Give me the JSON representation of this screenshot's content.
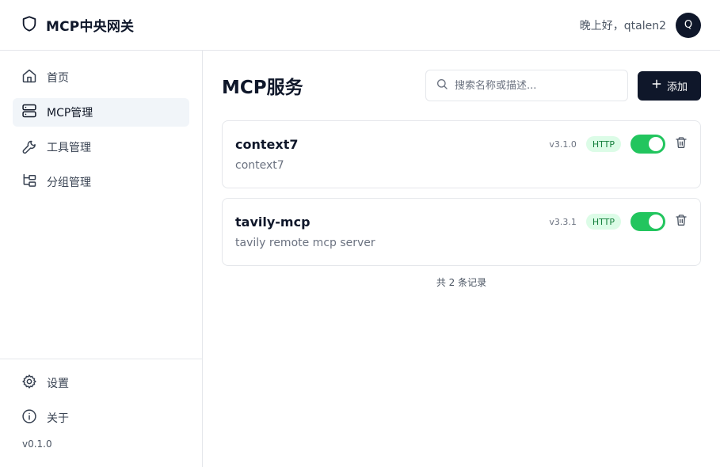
{
  "header": {
    "title": "MCP中央网关",
    "greeting": "晚上好，qtalen2",
    "avatar_initial": "Q"
  },
  "sidebar": {
    "items": [
      {
        "label": "首页",
        "icon": "home-icon",
        "active": false
      },
      {
        "label": "MCP管理",
        "icon": "server-icon",
        "active": true
      },
      {
        "label": "工具管理",
        "icon": "wrench-icon",
        "active": false
      },
      {
        "label": "分组管理",
        "icon": "folder-tree-icon",
        "active": false
      }
    ],
    "bottom_items": [
      {
        "label": "设置",
        "icon": "gear-icon"
      },
      {
        "label": "关于",
        "icon": "info-icon"
      }
    ],
    "version": "v0.1.0"
  },
  "main": {
    "title": "MCP服务",
    "search_placeholder": "搜索名称或描述...",
    "add_label": "添加",
    "services": [
      {
        "name": "context7",
        "version": "v3.1.0",
        "protocol": "HTTP",
        "enabled": true,
        "description": "context7"
      },
      {
        "name": "tavily-mcp",
        "version": "v3.3.1",
        "protocol": "HTTP",
        "enabled": true,
        "description": "tavily remote mcp server"
      }
    ],
    "total_text": "共 2 条记录"
  },
  "colors": {
    "primary": "#0f172a",
    "toggle_on": "#22c55e",
    "badge_bg": "#dcfce7",
    "badge_text": "#15803d",
    "active_nav_bg": "#f1f5f9",
    "border": "#e5e7eb"
  }
}
